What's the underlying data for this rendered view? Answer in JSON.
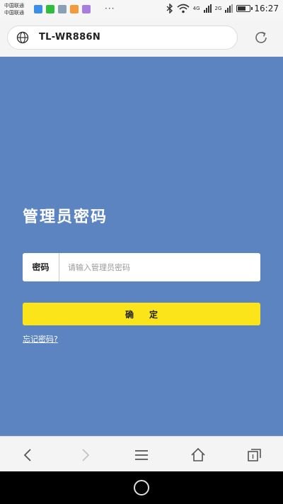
{
  "status_bar": {
    "carrier_line1": "中国联通",
    "carrier_line2": "中国联通",
    "more": "···",
    "network_1": "4G",
    "network_2": "2G",
    "time": "16:27",
    "battery_level": 0.6
  },
  "address_bar": {
    "url": "TL-WR886N"
  },
  "login": {
    "title": "管理员密码",
    "password_label": "密码",
    "password_placeholder": "请输入管理员密码",
    "password_value": "",
    "confirm_label": "确定",
    "forgot_link": "忘记密码?"
  },
  "colors": {
    "page_bg": "#5b84c1",
    "confirm_bg": "#fbe51a"
  }
}
